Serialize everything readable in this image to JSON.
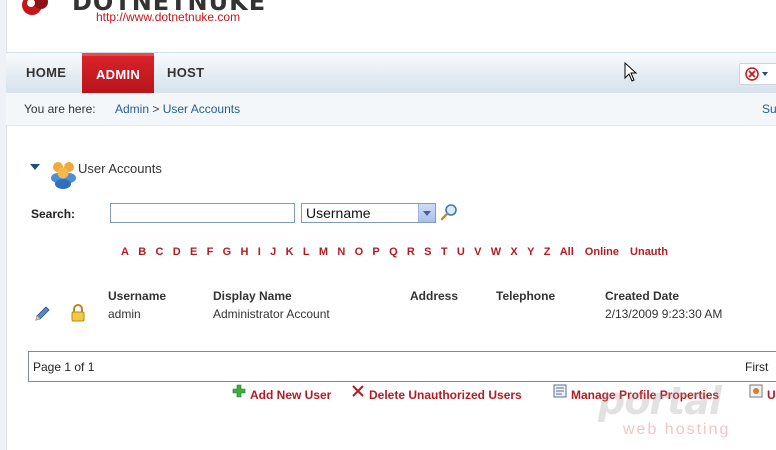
{
  "brand": {
    "wordmark": "DOTNETNUKE",
    "url": "http://www.dotnetnuke.com"
  },
  "nav": {
    "items": [
      {
        "label": "HOME"
      },
      {
        "label": "ADMIN",
        "active": true
      },
      {
        "label": "HOST"
      }
    ],
    "language_icon": "flag-dropdown-icon"
  },
  "breadcrumb": {
    "prefix": "You are here:",
    "items": [
      "Admin",
      "User Accounts"
    ],
    "separator": ">",
    "right_link": "Su"
  },
  "module": {
    "title": "User Accounts"
  },
  "search": {
    "label": "Search:",
    "value": "",
    "field_selected": "Username"
  },
  "letters": [
    "A",
    "B",
    "C",
    "D",
    "E",
    "F",
    "G",
    "H",
    "I",
    "J",
    "K",
    "L",
    "M",
    "N",
    "O",
    "P",
    "Q",
    "R",
    "S",
    "T",
    "U",
    "V",
    "W",
    "X",
    "Y",
    "Z"
  ],
  "filters": [
    "All",
    "Online",
    "Unauth"
  ],
  "table": {
    "headers": [
      "Username",
      "Display Name",
      "Address",
      "Telephone",
      "Created Date"
    ],
    "rows": [
      {
        "username": "admin",
        "display_name": "Administrator Account",
        "address": "",
        "telephone": "",
        "created": "2/13/2009 9:23:30 AM"
      }
    ]
  },
  "pager": {
    "info": "Page 1 of 1",
    "first": "First"
  },
  "actions": [
    {
      "label": "Add New User",
      "icon": "plus-icon"
    },
    {
      "label": "Delete Unauthorized Users",
      "icon": "x-icon"
    },
    {
      "label": "Manage Profile Properties",
      "icon": "properties-icon"
    },
    {
      "label": "U",
      "icon": "settings-icon"
    }
  ],
  "watermark": {
    "big": "portal",
    "small": "web hosting"
  },
  "colors": {
    "accent_red": "#b21c24",
    "nav_active": "#c4161c",
    "link_blue": "#2a5d8c"
  }
}
